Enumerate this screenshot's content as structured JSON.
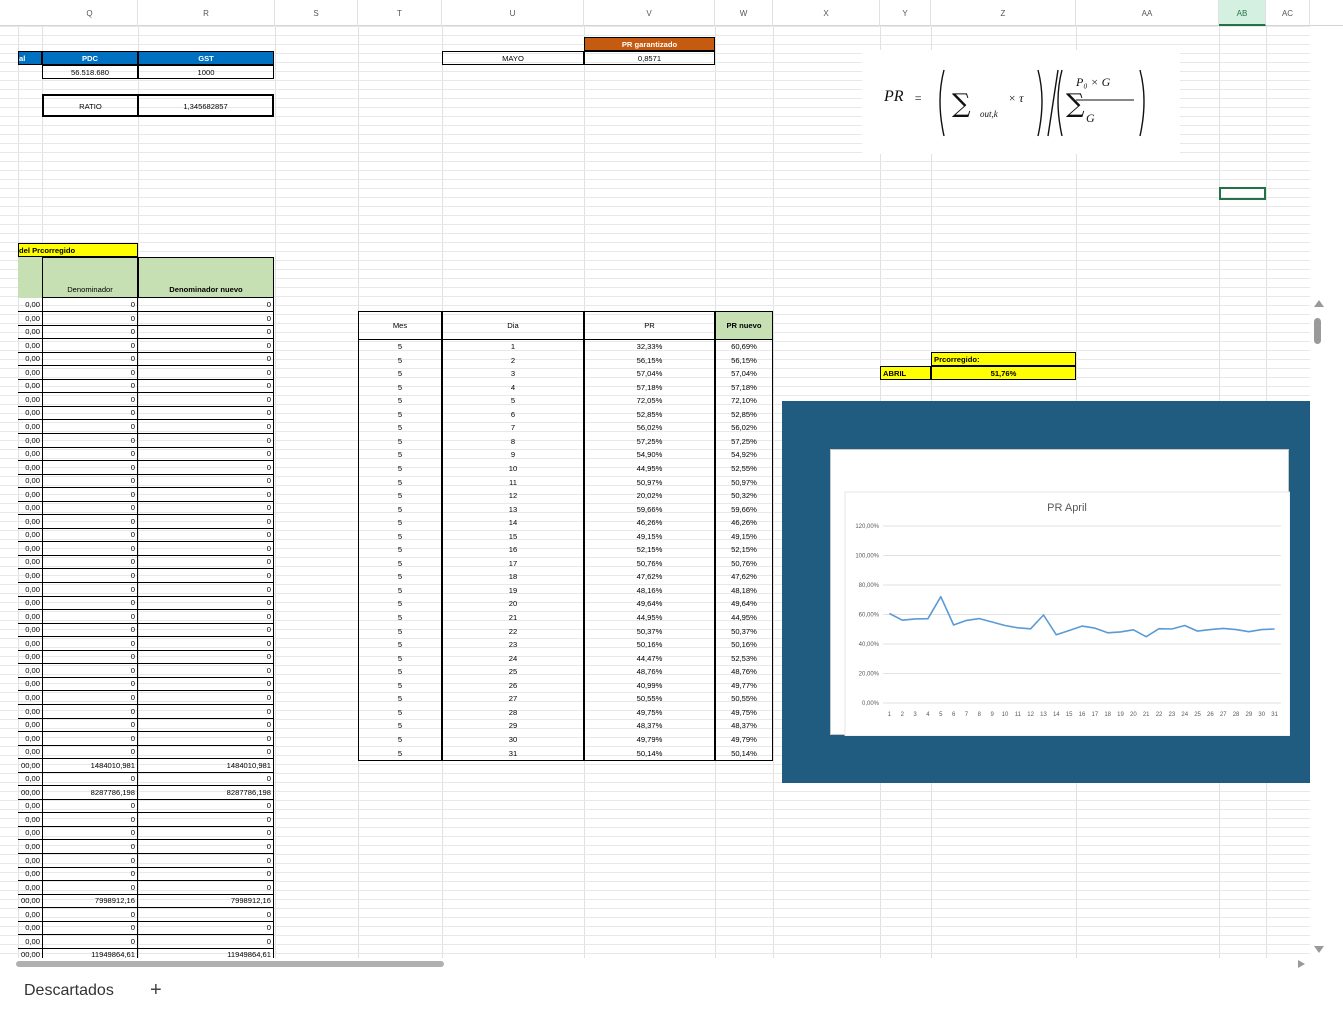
{
  "columns": [
    {
      "label": "Q"
    },
    {
      "label": "R"
    },
    {
      "label": "S"
    },
    {
      "label": "T"
    },
    {
      "label": "U"
    },
    {
      "label": "V"
    },
    {
      "label": "W"
    },
    {
      "label": "X"
    },
    {
      "label": "Y"
    },
    {
      "label": "Z"
    },
    {
      "label": "AA"
    },
    {
      "label": "AB"
    },
    {
      "label": "AC"
    }
  ],
  "header_boxes": {
    "col_p_fragment": "al",
    "pdc_label": "PDC",
    "gst_label": "GST",
    "pdc_value": "56.518.680",
    "gst_value": "1000",
    "ratio_label": "RATIO",
    "ratio_value": "1,345682857",
    "pr_garantizado_label": "PR garantizado",
    "mayo_label": "MAYO",
    "pr_garantizado_value": "0,8571"
  },
  "formula": {
    "lhs": "PR",
    "eq": "=",
    "num_sub": "out,k",
    "num_term": "× τ",
    "den_num": "P₀ × G",
    "den_den": "G"
  },
  "left_table": {
    "title": "del Prcorregido",
    "col_header_denominador": "Denominador",
    "col_header_nuevo": "Denominador nuevo",
    "rows": [
      [
        "0,00",
        "0",
        "0"
      ],
      [
        "0,00",
        "0",
        "0"
      ],
      [
        "0,00",
        "0",
        "0"
      ],
      [
        "0,00",
        "0",
        "0"
      ],
      [
        "0,00",
        "0",
        "0"
      ],
      [
        "0,00",
        "0",
        "0"
      ],
      [
        "0,00",
        "0",
        "0"
      ],
      [
        "0,00",
        "0",
        "0"
      ],
      [
        "0,00",
        "0",
        "0"
      ],
      [
        "0,00",
        "0",
        "0"
      ],
      [
        "0,00",
        "0",
        "0"
      ],
      [
        "0,00",
        "0",
        "0"
      ],
      [
        "0,00",
        "0",
        "0"
      ],
      [
        "0,00",
        "0",
        "0"
      ],
      [
        "0,00",
        "0",
        "0"
      ],
      [
        "0,00",
        "0",
        "0"
      ],
      [
        "0,00",
        "0",
        "0"
      ],
      [
        "0,00",
        "0",
        "0"
      ],
      [
        "0,00",
        "0",
        "0"
      ],
      [
        "0,00",
        "0",
        "0"
      ],
      [
        "0,00",
        "0",
        "0"
      ],
      [
        "0,00",
        "0",
        "0"
      ],
      [
        "0,00",
        "0",
        "0"
      ],
      [
        "0,00",
        "0",
        "0"
      ],
      [
        "0,00",
        "0",
        "0"
      ],
      [
        "0,00",
        "0",
        "0"
      ],
      [
        "0,00",
        "0",
        "0"
      ],
      [
        "0,00",
        "0",
        "0"
      ],
      [
        "0,00",
        "0",
        "0"
      ],
      [
        "0,00",
        "0",
        "0"
      ],
      [
        "0,00",
        "0",
        "0"
      ],
      [
        "0,00",
        "0",
        "0"
      ],
      [
        "0,00",
        "0",
        "0"
      ],
      [
        "0,00",
        "0",
        "0"
      ],
      [
        "00,00",
        "1484010,981",
        "1484010,981"
      ],
      [
        "0,00",
        "0",
        "0"
      ],
      [
        "00,00",
        "8287786,198",
        "8287786,198"
      ],
      [
        "0,00",
        "0",
        "0"
      ],
      [
        "0,00",
        "0",
        "0"
      ],
      [
        "0,00",
        "0",
        "0"
      ],
      [
        "0,00",
        "0",
        "0"
      ],
      [
        "0,00",
        "0",
        "0"
      ],
      [
        "0,00",
        "0",
        "0"
      ],
      [
        "0,00",
        "0",
        "0"
      ],
      [
        "00,00",
        "7998912,16",
        "7998912,16"
      ],
      [
        "0,00",
        "0",
        "0"
      ],
      [
        "0,00",
        "0",
        "0"
      ],
      [
        "0,00",
        "0",
        "0"
      ],
      [
        "00,00",
        "11949864,61",
        "11949864,61"
      ]
    ]
  },
  "pr_table": {
    "headers": [
      "Mes",
      "Dia",
      "PR",
      "PR nuevo"
    ],
    "rows": [
      [
        "5",
        "1",
        "32,33%",
        "60,69%"
      ],
      [
        "5",
        "2",
        "56,15%",
        "56,15%"
      ],
      [
        "5",
        "3",
        "57,04%",
        "57,04%"
      ],
      [
        "5",
        "4",
        "57,18%",
        "57,18%"
      ],
      [
        "5",
        "5",
        "72,05%",
        "72,10%"
      ],
      [
        "5",
        "6",
        "52,85%",
        "52,85%"
      ],
      [
        "5",
        "7",
        "56,02%",
        "56,02%"
      ],
      [
        "5",
        "8",
        "57,25%",
        "57,25%"
      ],
      [
        "5",
        "9",
        "54,90%",
        "54,92%"
      ],
      [
        "5",
        "10",
        "44,95%",
        "52,55%"
      ],
      [
        "5",
        "11",
        "50,97%",
        "50,97%"
      ],
      [
        "5",
        "12",
        "20,02%",
        "50,32%"
      ],
      [
        "5",
        "13",
        "59,66%",
        "59,66%"
      ],
      [
        "5",
        "14",
        "46,26%",
        "46,26%"
      ],
      [
        "5",
        "15",
        "49,15%",
        "49,15%"
      ],
      [
        "5",
        "16",
        "52,15%",
        "52,15%"
      ],
      [
        "5",
        "17",
        "50,76%",
        "50,76%"
      ],
      [
        "5",
        "18",
        "47,62%",
        "47,62%"
      ],
      [
        "5",
        "19",
        "48,16%",
        "48,18%"
      ],
      [
        "5",
        "20",
        "49,64%",
        "49,64%"
      ],
      [
        "5",
        "21",
        "44,95%",
        "44,95%"
      ],
      [
        "5",
        "22",
        "50,37%",
        "50,37%"
      ],
      [
        "5",
        "23",
        "50,16%",
        "50,16%"
      ],
      [
        "5",
        "24",
        "44,47%",
        "52,53%"
      ],
      [
        "5",
        "25",
        "48,76%",
        "48,76%"
      ],
      [
        "5",
        "26",
        "40,99%",
        "49,77%"
      ],
      [
        "5",
        "27",
        "50,55%",
        "50,55%"
      ],
      [
        "5",
        "28",
        "49,75%",
        "49,75%"
      ],
      [
        "5",
        "29",
        "48,37%",
        "48,37%"
      ],
      [
        "5",
        "30",
        "49,79%",
        "49,79%"
      ],
      [
        "5",
        "31",
        "50,14%",
        "50,14%"
      ]
    ]
  },
  "prcorregido": {
    "label": "Prcorregido:",
    "month": "ABRIL",
    "value": "51,76%"
  },
  "chart_data": {
    "type": "line",
    "title": "PR April",
    "categories": [
      "1",
      "2",
      "3",
      "4",
      "5",
      "6",
      "7",
      "8",
      "9",
      "10",
      "11",
      "12",
      "13",
      "14",
      "15",
      "16",
      "17",
      "18",
      "19",
      "20",
      "21",
      "22",
      "23",
      "24",
      "25",
      "26",
      "27",
      "28",
      "29",
      "30",
      "31"
    ],
    "series": [
      {
        "values": [
          60.69,
          56.15,
          57.04,
          57.18,
          72.1,
          52.85,
          56.02,
          57.25,
          54.92,
          52.55,
          50.97,
          50.32,
          59.66,
          46.26,
          49.15,
          52.15,
          50.76,
          47.62,
          48.18,
          49.64,
          44.95,
          50.37,
          50.16,
          52.53,
          48.76,
          49.77,
          50.55,
          49.75,
          48.37,
          49.79,
          50.14
        ]
      }
    ],
    "yticks": [
      "0,00%",
      "20,00%",
      "40,00%",
      "60,00%",
      "80,00%",
      "100,00%",
      "120,00%"
    ],
    "ylim": [
      0,
      120
    ],
    "color": "#5b9bd5",
    "grid": true
  },
  "sheet_tabs": {
    "active": "Descartados",
    "add": "+"
  }
}
